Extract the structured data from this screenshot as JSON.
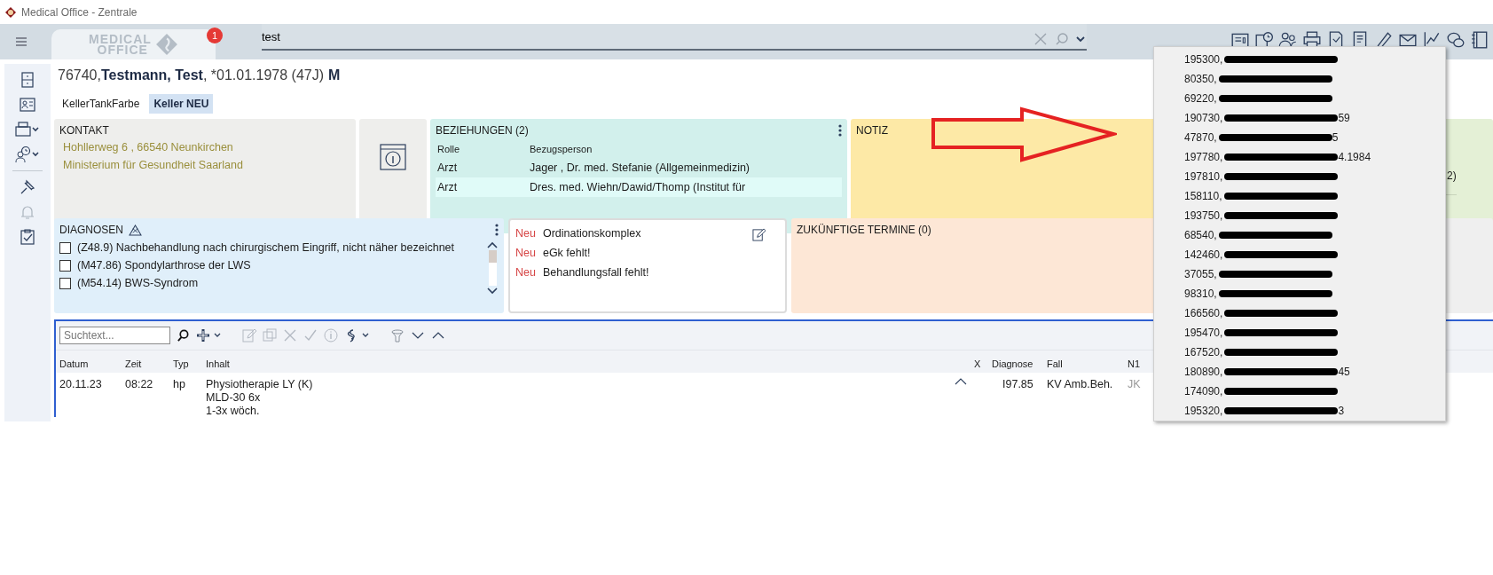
{
  "window": {
    "title": "Medical Office - Zentrale"
  },
  "top_bar": {
    "logo": {
      "line1": "MEDICAL",
      "line2": "OFFICE"
    },
    "notification_count": "1",
    "search": {
      "value": "test"
    }
  },
  "search_results": [
    {
      "number": "195300,"
    },
    {
      "number": "80350,"
    },
    {
      "number": "69220,"
    },
    {
      "number": "190730,",
      "tail": "59"
    },
    {
      "number": "47870,",
      "tail": "5"
    },
    {
      "number": "197780,",
      "tail": "4.1984"
    },
    {
      "number": "197810,"
    },
    {
      "number": "158110,"
    },
    {
      "number": "193750,"
    },
    {
      "number": "68540,"
    },
    {
      "number": "142460,"
    },
    {
      "number": "37055,"
    },
    {
      "number": "98310,"
    },
    {
      "number": "166560,"
    },
    {
      "number": "195470,"
    },
    {
      "number": "167520,"
    },
    {
      "number": "180890,",
      "tail": "45"
    },
    {
      "number": "174090,"
    },
    {
      "number": "195320,",
      "tail": "3"
    }
  ],
  "patient": {
    "id": "76740,",
    "name": "Testmann, Test",
    "birth": ", *01.01.1978 (47J)",
    "sex": "M"
  },
  "tabs": [
    {
      "label": "KellerTankFarbe",
      "selected": false
    },
    {
      "label": "Keller NEU",
      "selected": true
    }
  ],
  "kontakt": {
    "title": "KONTAKT",
    "lines": [
      "Hohllerweg 6 , 66540 Neunkirchen",
      "Ministerium für Gesundheit Saarland"
    ]
  },
  "beziehungen": {
    "title": "BEZIEHUNGEN (2)",
    "columns": [
      "Rolle",
      "Bezugsperson"
    ],
    "rows": [
      {
        "rolle": "Arzt",
        "person": "Jager , Dr. med. Stefanie (Allgemeinmedizin)",
        "selected": false
      },
      {
        "rolle": "Arzt",
        "person": "Dres. med. Wiehn/Dawid/Thomp (Institut für",
        "selected": true
      }
    ]
  },
  "notiz": {
    "title": "NOTIZ"
  },
  "side_card": {
    "text": "2)"
  },
  "diagnosen": {
    "title": "DIAGNOSEN",
    "items": [
      {
        "text": "(Z48.9) Nachbehandlung nach chirurgischem Eingriff, nicht näher bezeichnet",
        "checked": false
      },
      {
        "text": "(M47.86) Spondylarthrose der LWS",
        "checked": false
      },
      {
        "text": "(M54.14) BWS-Syndrom",
        "checked": false
      }
    ]
  },
  "hinweise": [
    {
      "tag": "Neu",
      "text": "Ordinationskomplex"
    },
    {
      "tag": "Neu",
      "text": "eGk fehlt!"
    },
    {
      "tag": "Neu",
      "text": "Behandlungsfall fehlt!"
    }
  ],
  "termine": {
    "title": "ZUKÜNFTIGE TERMINE (0)"
  },
  "journal": {
    "search": {
      "placeholder": "Suchtext..."
    },
    "columns": [
      "Datum",
      "Zeit",
      "Typ",
      "Inhalt",
      "X",
      "Diagnose",
      "Fall",
      "N1"
    ],
    "rows": [
      {
        "datum": "20.11.23",
        "zeit": "08:22",
        "typ": "hp",
        "inhalt": [
          "Physiotherapie LY (K)",
          "MLD-30 6x",
          "1-3x wöch."
        ],
        "diagnose": "I97.85",
        "fall": "KV Amb.Beh.",
        "n1": "JK"
      }
    ]
  }
}
